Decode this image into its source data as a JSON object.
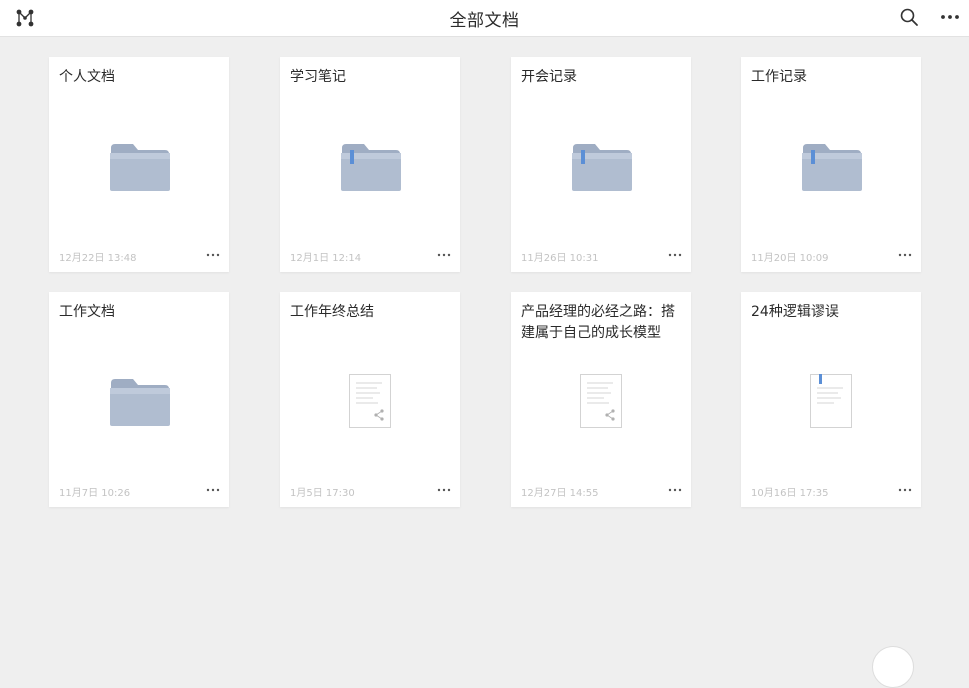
{
  "header": {
    "title": "全部文档"
  },
  "icons": {
    "logo": "mind-map-logo-icon",
    "search": "search-icon",
    "more": "more-horizontal-icon",
    "folder": "folder-icon",
    "document": "document-icon"
  },
  "colors": {
    "folder": "#a9b7cc",
    "bookmark": "#5b8fd6",
    "background": "#efefef"
  },
  "items": [
    {
      "name": "个人文档",
      "date": "12月22日 13:48",
      "type": "folder",
      "bookmarked": false
    },
    {
      "name": "学习笔记",
      "date": "12月1日 12:14",
      "type": "folder",
      "bookmarked": true
    },
    {
      "name": "开会记录",
      "date": "11月26日 10:31",
      "type": "folder",
      "bookmarked": true
    },
    {
      "name": "工作记录",
      "date": "11月20日 10:09",
      "type": "folder",
      "bookmarked": true
    },
    {
      "name": "工作文档",
      "date": "11月7日 10:26",
      "type": "folder",
      "bookmarked": false
    },
    {
      "name": "工作年终总结",
      "date": "1月5日 17:30",
      "type": "document",
      "bookmarked": false,
      "shared": true
    },
    {
      "name": "产品经理的必经之路：搭建属于自己的成长模型",
      "date": "12月27日 14:55",
      "type": "document",
      "bookmarked": false,
      "shared": true
    },
    {
      "name": "24种逻辑谬误",
      "date": "10月16日 17:35",
      "type": "document",
      "bookmarked": true,
      "shared": false
    }
  ]
}
